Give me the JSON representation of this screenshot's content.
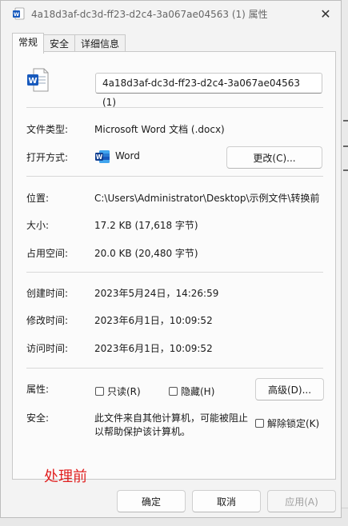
{
  "window": {
    "title": "4a18d3af-dc3d-ff23-d2c4-3a067ae04563 (1) 属性",
    "close_glyph": "✕"
  },
  "tabs": [
    {
      "label": "常规",
      "active": true
    },
    {
      "label": "安全",
      "active": false
    },
    {
      "label": "详细信息",
      "active": false
    }
  ],
  "file": {
    "name": "4a18d3af-dc3d-ff23-d2c4-3a067ae04563 (1)",
    "icon": "word-document-icon"
  },
  "rows": {
    "type_label": "文件类型:",
    "type_value": "Microsoft Word 文档 (.docx)",
    "open_label": "打开方式:",
    "open_value": "Word",
    "change_button": "更改(C)...",
    "location_label": "位置:",
    "location_value": "C:\\Users\\Administrator\\Desktop\\示例文件\\转换前",
    "size_label": "大小:",
    "size_value": "17.2 KB (17,618 字节)",
    "disk_label": "占用空间:",
    "disk_value": "20.0 KB (20,480 字节)",
    "created_label": "创建时间:",
    "created_value": "2023年5月24日，14:26:59",
    "modified_label": "修改时间:",
    "modified_value": "2023年6月1日，10:09:52",
    "accessed_label": "访问时间:",
    "accessed_value": "2023年6月1日，10:09:52",
    "attr_label": "属性:",
    "readonly_label": "只读(R)",
    "hidden_label": "隐藏(H)",
    "advanced_button": "高级(D)...",
    "security_label": "安全:",
    "security_text_1": "此文件来自其他计算机，可能被阻止",
    "security_text_2": "以帮助保护该计算机。",
    "unblock_label": "解除锁定(K)"
  },
  "annotation": "处理前",
  "footer": {
    "ok": "确定",
    "cancel": "取消",
    "apply": "应用(A)"
  },
  "colors": {
    "word_blue": "#185abd",
    "annotation_red": "#e02020"
  }
}
